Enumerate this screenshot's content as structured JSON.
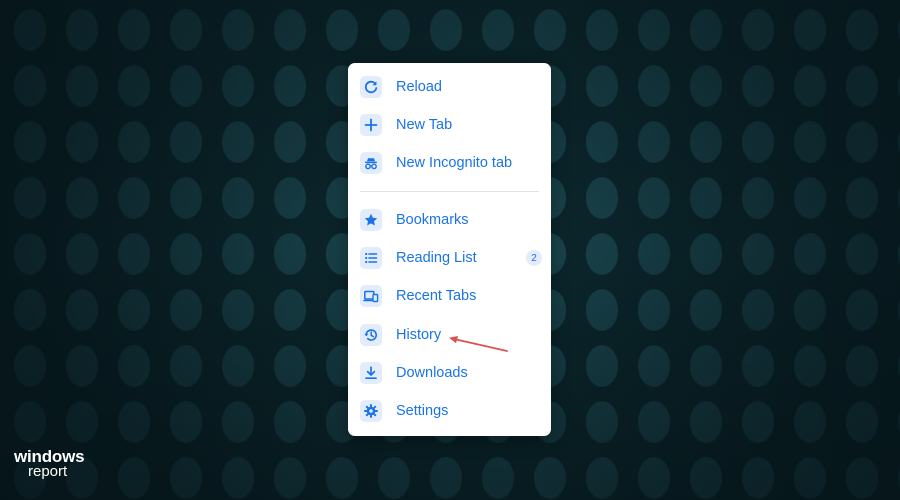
{
  "menu": {
    "items": [
      {
        "label": "Reload",
        "icon": "reload-icon"
      },
      {
        "label": "New Tab",
        "icon": "plus-icon"
      },
      {
        "label": "New Incognito tab",
        "icon": "incognito-icon"
      },
      {
        "label": "Bookmarks",
        "icon": "star-icon"
      },
      {
        "label": "Reading List",
        "icon": "list-icon",
        "badge": "2"
      },
      {
        "label": "Recent Tabs",
        "icon": "devices-icon"
      },
      {
        "label": "History",
        "icon": "history-icon"
      },
      {
        "label": "Downloads",
        "icon": "download-icon"
      },
      {
        "label": "Settings",
        "icon": "gear-icon"
      }
    ]
  },
  "watermark": {
    "line1": "windows",
    "line2": "report"
  },
  "colors": {
    "accent": "#1a73e8",
    "icon_bg": "#e3ecfb",
    "arrow": "#d9534f",
    "background": "#0c2a30"
  }
}
